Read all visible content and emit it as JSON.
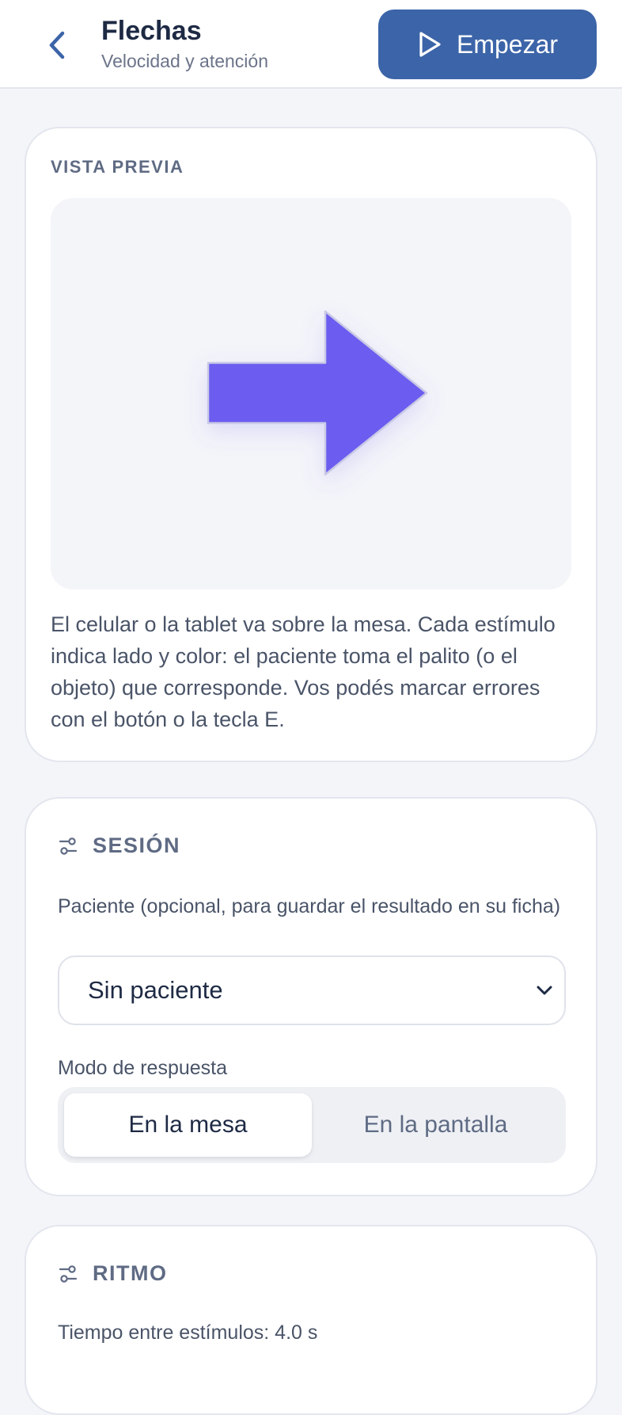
{
  "header": {
    "title": "Flechas",
    "subtitle": "Velocidad y atención",
    "start_label": "Empezar"
  },
  "preview": {
    "section_label": "VISTA PREVIA",
    "stimulus_icon": "arrow-right-icon",
    "arrow_color": "#6c5df0",
    "description": "El celular o la tablet va sobre la mesa. Cada estímulo indica lado y color: el paciente toma el palito (o el objeto) que corresponde. Vos podés marcar errores con el botón o la tecla E."
  },
  "session": {
    "section_label": "SESIÓN",
    "patient_label": "Paciente (opcional, para guardar el resultado en su ficha)",
    "patient_selected": "Sin paciente",
    "response_mode_label": "Modo de respuesta",
    "response_modes": [
      "En la mesa",
      "En la pantalla"
    ],
    "response_mode_selected": "En la mesa"
  },
  "rhythm": {
    "section_label": "RITMO",
    "interval_label": "Tiempo entre estímulos: 4.0 s"
  },
  "colors": {
    "accent": "#3c64a8",
    "arrow": "#6c5df0"
  }
}
